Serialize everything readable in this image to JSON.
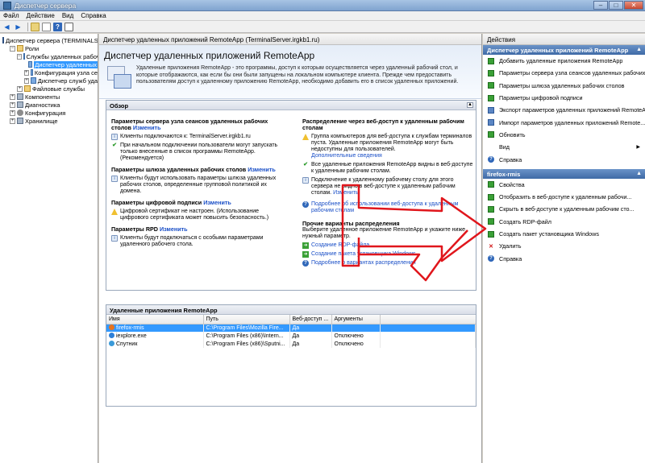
{
  "window": {
    "title": "Диспетчер сервера"
  },
  "menu": [
    "Файл",
    "Действие",
    "Вид",
    "Справка"
  ],
  "tree": [
    {
      "label": "Диспетчер сервера (TERMINALSE",
      "level": 0,
      "exp": "",
      "icon": "srv"
    },
    {
      "label": "Роли",
      "level": 1,
      "exp": "−",
      "icon": "fold"
    },
    {
      "label": "Службы удаленных рабоч",
      "level": 2,
      "exp": "−",
      "icon": "app"
    },
    {
      "label": "Диспетчер удаленных",
      "level": 3,
      "exp": "",
      "icon": "app",
      "selected": true
    },
    {
      "label": "Конфигурация узла се",
      "level": 3,
      "exp": "+",
      "icon": "app"
    },
    {
      "label": "Диспетчер служб уда",
      "level": 3,
      "exp": "+",
      "icon": "app"
    },
    {
      "label": "Файловые службы",
      "level": 2,
      "exp": "+",
      "icon": "fold"
    },
    {
      "label": "Компоненты",
      "level": 1,
      "exp": "+",
      "icon": "comp"
    },
    {
      "label": "Диагностика",
      "level": 1,
      "exp": "+",
      "icon": "comp"
    },
    {
      "label": "Конфигурация",
      "level": 1,
      "exp": "+",
      "icon": "gear"
    },
    {
      "label": "Хранилище",
      "level": 1,
      "exp": "+",
      "icon": "comp"
    }
  ],
  "middle": {
    "header": "Диспетчер удаленных приложений RemoteApp (TerminalServer.irgkb1.ru)",
    "banner_title": "Диспетчер удаленных приложений RemoteApp",
    "banner_desc": "Удаленные приложения RemoteApp - это программы, доступ к которым осуществляется через удаленный рабочий стол, и которые отображаются, как если бы они были запущены на локальном компьютере клиента. Прежде чем предоставить пользователям доступ к удаленному приложению RemoteApp, необходимо добавить его в список удаленных приложений.",
    "overview": {
      "title": "Обзор",
      "left": {
        "h1": "Параметры сервера узла сеансов удаленных рабочих столов",
        "h1_link": "Изменить",
        "i1": "Клиенты подключаются к: TerminalServer.irgkb1.ru",
        "i2": "При начальном подключении пользователи могут запускать только внесенные в список программы RemoteApp. (Рекомендуется)",
        "h2": "Параметры шлюза удаленных рабочих столов",
        "h2_link": "Изменить",
        "i3": "Клиенты будут использовать параметры шлюза удаленных рабочих столов, определенные групповой политикой их домена.",
        "h3": "Параметры цифровой подписи",
        "h3_link": "Изменить",
        "i4": "Цифровой сертификат не настроен. (Использование цифрового сертификата может повысить безопасность.)",
        "h4": "Параметры RPD",
        "h4_link": "Изменить",
        "i5": "Клиенты будут подключаться с особыми параметрами удаленного рабочего стола."
      },
      "right": {
        "h1": "Распределение через веб-доступ к удаленным рабочим столам",
        "i1": "Группа компьютеров для веб-доступа к службам терминалов пуста. Удаленные приложения RemoteApp могут быть недоступны для пользователей.",
        "i1_link": "Дополнительные сведения",
        "i2": "Все удаленные приложения RemoteApp видны в веб-доступе к удаленным рабочим столам.",
        "i3": "Подключение к удаленному рабочему столу для этого сервера не видно в веб-доступе к удаленным рабочим столам.",
        "i3_link": "Изменить",
        "help_link": "Подробнее об использовании веб-доступа к удаленным рабочим столам",
        "h2": "Прочие варианты распределения",
        "h2_desc": "Выберите удаленное приложение RemoteApp и укажите ниже нужный параметр.",
        "l1": "Создание RDP-файла",
        "l2": "Создание пакета установщика Windows",
        "l3": "Подробнее о вариантах распределения"
      }
    },
    "apps": {
      "title": "Удаленные приложения RemoteApp",
      "columns": [
        "Имя",
        "Путь",
        "Веб-доступ ...",
        "Аргументы"
      ],
      "rows": [
        {
          "name": "firefox-rmis",
          "path": "C:\\Program Files\\Mozilla Fire...",
          "web": "Да",
          "args": "",
          "icon_color": "#e8731d",
          "selected": true
        },
        {
          "name": "iexplore.exe",
          "path": "C:\\Program Files (x86)\\Intern...",
          "web": "Да",
          "args": "Отключено",
          "icon_color": "#2d7fd8",
          "selected": false
        },
        {
          "name": "Спутник",
          "path": "C:\\Program Files (x86)\\Sputni...",
          "web": "Да",
          "args": "Отключено",
          "icon_color": "#3a9ad9",
          "selected": false
        }
      ]
    }
  },
  "actions": {
    "title": "Действия",
    "section1": "Диспетчер удаленных приложений RemoteApp",
    "items1": [
      {
        "label": "Добавить удаленные приложения RemoteApp",
        "icon": "green"
      },
      {
        "label": "Параметры сервера узла сеансов удаленных рабочих",
        "icon": "green"
      },
      {
        "label": "Параметры шлюза удаленных рабочих столов",
        "icon": "green"
      },
      {
        "label": "Параметры цифровой подписи",
        "icon": "green"
      },
      {
        "label": "Экспорт параметров удаленных приложений RemoteA...",
        "icon": "blue"
      },
      {
        "label": "Импорт параметров удаленных приложений Remote...",
        "icon": "blue"
      },
      {
        "label": "Обновить",
        "icon": "green"
      },
      {
        "label": "Вид",
        "icon": "none",
        "submenu": true
      },
      {
        "label": "Справка",
        "icon": "help"
      }
    ],
    "section2": "firefox-rmis",
    "items2": [
      {
        "label": "Свойства",
        "icon": "green"
      },
      {
        "label": "Отобразить в веб-доступе к удаленным рабочи...",
        "icon": "green"
      },
      {
        "label": "Скрыть в веб-доступе к удаленным рабочим сто...",
        "icon": "green"
      },
      {
        "label": "Создать RDP-файл",
        "icon": "green"
      },
      {
        "label": "Создать пакет установщика Windows",
        "icon": "green"
      },
      {
        "label": "Удалить",
        "icon": "del"
      },
      {
        "label": "Справка",
        "icon": "help"
      }
    ]
  },
  "colors": {
    "accent": "#3399ff",
    "link": "#1a4fc7",
    "annotation": "#e0161c"
  }
}
